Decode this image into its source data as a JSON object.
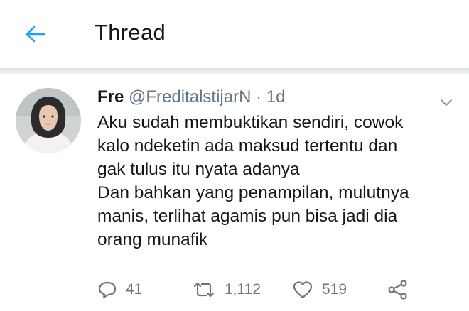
{
  "header": {
    "title": "Thread",
    "back_icon": "arrow-left-icon",
    "accent": "#1da1f2"
  },
  "tweet": {
    "name": "Fre",
    "handle": "@FreditalstijarN",
    "separator": "·",
    "time": "1d",
    "lines": [
      "Aku sudah membuktikan sendiri, cowok",
      "kalo ndeketin ada maksud tertentu dan",
      "gak tulus itu nyata adanya",
      "Dan bahkan yang penampilan, mulutnya",
      "manis, terlihat agamis pun bisa jadi dia",
      "orang munafik"
    ],
    "actions": {
      "replies": "41",
      "retweets": "1,112",
      "likes": "519"
    }
  },
  "icons": {
    "reply": "reply-icon",
    "retweet": "retweet-icon",
    "like": "heart-icon",
    "share": "share-icon",
    "more": "chevron-down-icon"
  }
}
